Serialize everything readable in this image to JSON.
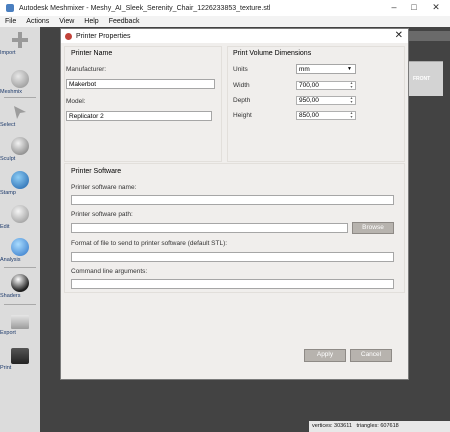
{
  "window": {
    "title": "Autodesk Meshmixer - Meshy_AI_Sleek_Serenity_Chair_1226233853_texture.stl"
  },
  "menu": [
    "File",
    "Actions",
    "View",
    "Help",
    "Feedback"
  ],
  "tools": [
    {
      "label": "Import",
      "icon": "plus-icon"
    },
    {
      "label": "Meshmix",
      "icon": "meshmix-icon"
    },
    {
      "label": "Select",
      "icon": "select-arrow-icon"
    },
    {
      "label": "Sculpt",
      "icon": "brush-icon"
    },
    {
      "label": "Stamp",
      "icon": "stamp-icon"
    },
    {
      "label": "Edit",
      "icon": "edit-icon"
    },
    {
      "label": "Analysis",
      "icon": "analysis-icon"
    },
    {
      "label": "Shaders",
      "icon": "shaders-sphere-icon"
    },
    {
      "label": "Export",
      "icon": "export-icon"
    },
    {
      "label": "Print",
      "icon": "print-icon"
    }
  ],
  "viewcube": {
    "face": "FRONT"
  },
  "status": {
    "vertices": "vertices: 303611",
    "triangles": "triangles: 607618"
  },
  "dialog": {
    "title": "Printer Properties",
    "printer_name": {
      "title": "Printer Name",
      "manufacturer_label": "Manufacturer:",
      "manufacturer_value": "Makerbot",
      "model_label": "Model:",
      "model_value": "Replicator 2"
    },
    "volume": {
      "title": "Print Volume Dimensions",
      "units_label": "Units",
      "units_value": "mm",
      "width_label": "Width",
      "width_value": "700,00",
      "depth_label": "Depth",
      "depth_value": "950,00",
      "height_label": "Height",
      "height_value": "850,00"
    },
    "software": {
      "title": "Printer Software",
      "name_label": "Printer software name:",
      "name_value": "",
      "path_label": "Printer software path:",
      "path_value": "",
      "browse_label": "Browse",
      "format_label": "Format of file to send to printer software (default STL):",
      "format_value": "",
      "args_label": "Command line arguments:",
      "args_value": ""
    },
    "apply_label": "Apply",
    "cancel_label": "Cancel"
  }
}
